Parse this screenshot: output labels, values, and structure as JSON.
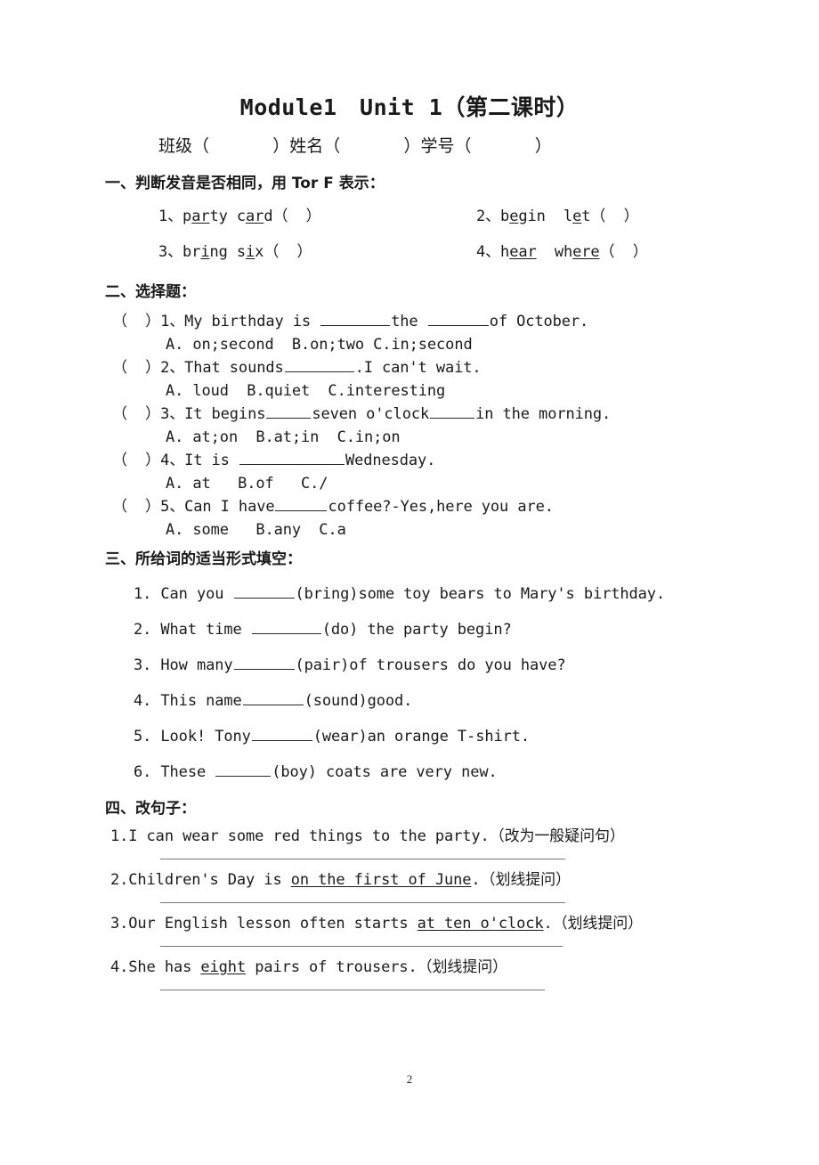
{
  "document": {
    "title": "Module1　Unit 1（第二课时）",
    "info_line": "班级（               ）姓名（               ）学号（               ）",
    "page_number": "2"
  },
  "section1": {
    "heading": "一、判断发音是否相同，用 Tor F 表示：",
    "items": [
      {
        "num": "1、",
        "word1_pre": "p",
        "word1_mid": "ar",
        "word1_post": "ty",
        "word2_pre": " c",
        "word2_mid": "ar",
        "word2_post": "d",
        "paren": "（  ）"
      },
      {
        "num": "2、",
        "word1_pre": "b",
        "word1_mid": "e",
        "word1_post": "gin",
        "word2_pre": "  l",
        "word2_mid": "e",
        "word2_post": "t",
        "paren": "（  ）"
      },
      {
        "num": "3、",
        "word1_pre": "br",
        "word1_mid": "i",
        "word1_post": "ng",
        "word2_pre": " s",
        "word2_mid": "i",
        "word2_post": "x",
        "paren": "（  ）"
      },
      {
        "num": "4、",
        "word1_pre": "h",
        "word1_mid": "ear",
        "word1_post": "",
        "word2_pre": "  wh",
        "word2_mid": "ere",
        "word2_post": "",
        "paren": "（  ）"
      }
    ]
  },
  "section2": {
    "heading": "二、选择题：",
    "questions": [
      {
        "bracket": "（  ）",
        "num": "1、",
        "stem_a": "My birthday is ",
        "stem_b": "the ",
        "stem_c": "of October.",
        "options": "A. on;second  B.on;two C.in;second"
      },
      {
        "bracket": "（  ）",
        "num": "2、",
        "stem_a": "That sounds",
        "stem_b": ".I can't wait.",
        "stem_c": "",
        "options": "A. loud  B.quiet  C.interesting"
      },
      {
        "bracket": "（  ）",
        "num": "3、",
        "stem_a": "It begins",
        "stem_b": "seven o'clock",
        "stem_c": "in the morning.",
        "options": "A. at;on  B.at;in  C.in;on"
      },
      {
        "bracket": "（  ）",
        "num": "4、",
        "stem_a": "It is ",
        "stem_b": "Wednesday.",
        "stem_c": "",
        "options": "A. at   B.of   C./"
      },
      {
        "bracket": "（  ）",
        "num": "5、",
        "stem_a": "Can I have",
        "stem_b": "coffee?-Yes,here you are.",
        "stem_c": "",
        "options": "A. some   B.any  C.a"
      }
    ]
  },
  "section3": {
    "heading": "三、所给词的适当形式填空：",
    "items": [
      {
        "num": "1.",
        "pre": " Can you ",
        "post": "(bring)some toy bears to Mary's birthday."
      },
      {
        "num": "2.",
        "pre": " What time ",
        "post": "(do) the party begin?"
      },
      {
        "num": "3.",
        "pre": " How many",
        "post": "(pair)of trousers do you have?"
      },
      {
        "num": "4.",
        "pre": " This name",
        "post": "(sound)good."
      },
      {
        "num": "5.",
        "pre": " Look! Tony",
        "post": "(wear)an orange T-shirt."
      },
      {
        "num": "6.",
        "pre": " These ",
        "post": "(boy) coats are very new."
      }
    ]
  },
  "section4": {
    "heading": "四、改句子：",
    "items": [
      {
        "num": "1.",
        "plain_a": "I can wear some red things to the party.",
        "underlined": "",
        "plain_b": "（改为一般疑问句）"
      },
      {
        "num": "2.",
        "plain_a": "Children's Day is ",
        "underlined": "on the first of June",
        "plain_b": ".（划线提问）"
      },
      {
        "num": "3.",
        "plain_a": "Our English lesson often starts ",
        "underlined": "at ten o'clock",
        "plain_b": ".（划线提问）"
      },
      {
        "num": "4.",
        "plain_a": "She has ",
        "underlined": "eight",
        "plain_b": " pairs of trousers.（划线提问）"
      }
    ]
  }
}
